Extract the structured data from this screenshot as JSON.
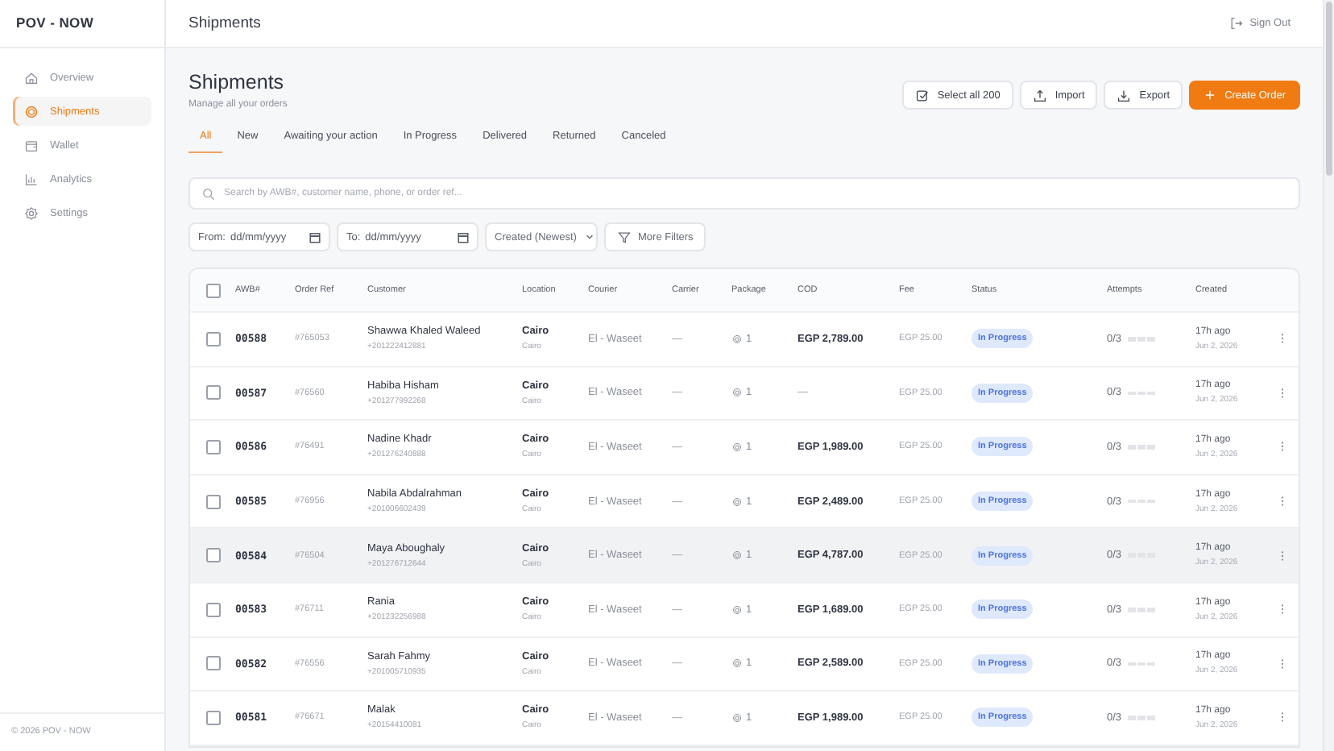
{
  "sidebar": {
    "logo": "POV - NOW",
    "items": [
      {
        "label": "Overview",
        "selected": false
      },
      {
        "label": "Shipments",
        "selected": true
      },
      {
        "label": "Wallet",
        "selected": false
      },
      {
        "label": "Analytics",
        "selected": false
      },
      {
        "label": "Settings",
        "selected": false
      }
    ],
    "footer": "© 2026 POV - NOW"
  },
  "header": {
    "title": "Shipments",
    "sign_out": "Sign Out"
  },
  "page": {
    "title": "Shipments",
    "subtitle": "Manage all your orders",
    "actions": [
      {
        "label": "Select all 200",
        "kind": "outline"
      },
      {
        "label": "Import",
        "kind": "outline"
      },
      {
        "label": "Export",
        "kind": "outline"
      },
      {
        "label": "Create Order",
        "kind": "primary"
      }
    ]
  },
  "tabs": [
    {
      "label": "All",
      "selected": true
    },
    {
      "label": "New",
      "selected": false
    },
    {
      "label": "Awaiting your action",
      "selected": false
    },
    {
      "label": "In Progress",
      "selected": false
    },
    {
      "label": "Delivered",
      "selected": false
    },
    {
      "label": "Returned",
      "selected": false
    },
    {
      "label": "Canceled",
      "selected": false
    }
  ],
  "search": {
    "placeholder": "Search by AWB#, customer name, phone, or order ref..."
  },
  "filters": {
    "from": {
      "label": "From:",
      "placeholder": "dd/mm/yyyy"
    },
    "to": {
      "label": "To:",
      "placeholder": "dd/mm/yyyy"
    },
    "sort": "Created (Newest)",
    "more": "More Filters"
  },
  "table": {
    "all_checked": false,
    "columns": [
      "AWB#",
      "Order Ref",
      "Customer",
      "Location",
      "Courier",
      "Carrier",
      "Package",
      "COD",
      "Fee",
      "Status",
      "Attempts",
      "Created"
    ],
    "rows": [
      {
        "awb": "00588",
        "ref": "#765053",
        "name": "Shawwa Khaled Waleed",
        "phone": "+201222412881",
        "city": "Cairo",
        "area": "Cairo",
        "courier": "El - Waseet",
        "carrier": "—",
        "package": "1",
        "cod": "EGP 2,789.00",
        "fee": "EGP 25.00",
        "status": "In Progress",
        "attempts": "0/3",
        "ago": "17h ago",
        "date": "Jun 2, 2026",
        "checked": false,
        "hovered": false
      },
      {
        "awb": "00587",
        "ref": "#76560",
        "name": "Habiba Hisham",
        "phone": "+201277992268",
        "city": "Cairo",
        "area": "Cairo",
        "courier": "El - Waseet",
        "carrier": "—",
        "package": "1",
        "cod": "—",
        "fee": "EGP 25.00",
        "status": "In Progress",
        "attempts": "0/3",
        "ago": "17h ago",
        "date": "Jun 2, 2026",
        "checked": false,
        "hovered": false
      },
      {
        "awb": "00586",
        "ref": "#76491",
        "name": "Nadine Khadr",
        "phone": "+201276240888",
        "city": "Cairo",
        "area": "Cairo",
        "courier": "El - Waseet",
        "carrier": "—",
        "package": "1",
        "cod": "EGP 1,989.00",
        "fee": "EGP 25.00",
        "status": "In Progress",
        "attempts": "0/3",
        "ago": "17h ago",
        "date": "Jun 2, 2026",
        "checked": false,
        "hovered": false
      },
      {
        "awb": "00585",
        "ref": "#76956",
        "name": "Nabila Abdalrahman",
        "phone": "+201006602439",
        "city": "Cairo",
        "area": "Cairo",
        "courier": "El - Waseet",
        "carrier": "—",
        "package": "1",
        "cod": "EGP 2,489.00",
        "fee": "EGP 25.00",
        "status": "In Progress",
        "attempts": "0/3",
        "ago": "17h ago",
        "date": "Jun 2, 2026",
        "checked": false,
        "hovered": false
      },
      {
        "awb": "00584",
        "ref": "#76504",
        "name": "Maya Aboughaly",
        "phone": "+201276712644",
        "city": "Cairo",
        "area": "Cairo",
        "courier": "El - Waseet",
        "carrier": "—",
        "package": "1",
        "cod": "EGP 4,787.00",
        "fee": "EGP 25.00",
        "status": "In Progress",
        "attempts": "0/3",
        "ago": "17h ago",
        "date": "Jun 2, 2026",
        "checked": false,
        "hovered": true
      },
      {
        "awb": "00583",
        "ref": "#76711",
        "name": "Rania",
        "phone": "+201232256988",
        "city": "Cairo",
        "area": "Cairo",
        "courier": "El - Waseet",
        "carrier": "—",
        "package": "1",
        "cod": "EGP 1,689.00",
        "fee": "EGP 25.00",
        "status": "In Progress",
        "attempts": "0/3",
        "ago": "17h ago",
        "date": "Jun 2, 2026",
        "checked": false,
        "hovered": false
      },
      {
        "awb": "00582",
        "ref": "#76556",
        "name": "Sarah Fahmy",
        "phone": "+201005710935",
        "city": "Cairo",
        "area": "Cairo",
        "courier": "El - Waseet",
        "carrier": "—",
        "package": "1",
        "cod": "EGP 2,589.00",
        "fee": "EGP 25.00",
        "status": "In Progress",
        "attempts": "0/3",
        "ago": "17h ago",
        "date": "Jun 2, 2026",
        "checked": false,
        "hovered": false
      },
      {
        "awb": "00581",
        "ref": "#76671",
        "name": "Malak",
        "phone": "+20154410081",
        "city": "Cairo",
        "area": "Cairo",
        "courier": "El - Waseet",
        "carrier": "—",
        "package": "1",
        "cod": "EGP 1,989.00",
        "fee": "EGP 25.00",
        "status": "In Progress",
        "attempts": "0/3",
        "ago": "17h ago",
        "date": "Jun 2, 2026",
        "checked": false,
        "hovered": false
      }
    ]
  }
}
